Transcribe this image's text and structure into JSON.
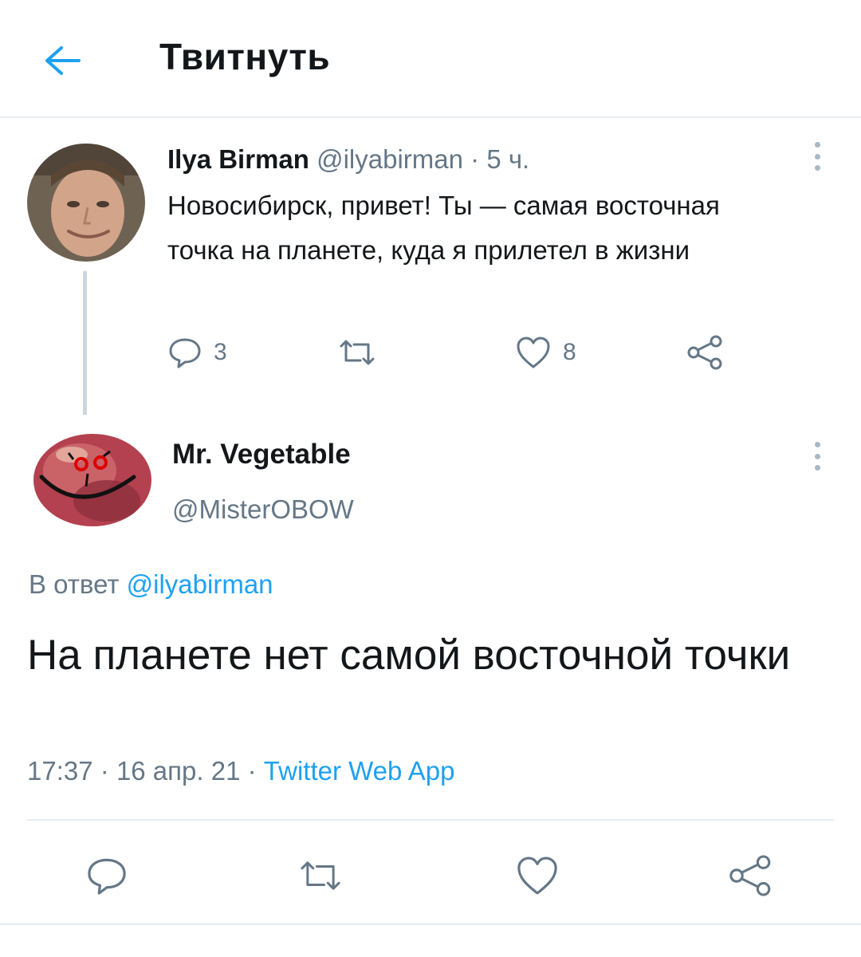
{
  "header": {
    "title": "Твитнуть",
    "back_icon": "arrow-left-icon",
    "accent": "#1da1f2"
  },
  "parent_tweet": {
    "author_name": "Ilya Birman",
    "handle": "@ilyabirman",
    "separator": "·",
    "time": "5 ч.",
    "text": "Новосибирск, привет! Ты — самая восточная точка на планете, куда я прилетел в жизни",
    "replies": "3",
    "likes": "8"
  },
  "main_tweet": {
    "author_name": "Mr. Vegetable",
    "handle": "@MisterOBOW",
    "reply_prefix": "В ответ",
    "reply_handle": "@ilyabirman",
    "text": "На планете нет самой восточной точки",
    "time": "17:37",
    "separator": "·",
    "date": "16 апр. 21",
    "source": "Twitter Web App"
  },
  "colors": {
    "text": "#14171a",
    "secondary": "#657786",
    "link": "#1da1f2",
    "border": "#e6ecf0"
  }
}
